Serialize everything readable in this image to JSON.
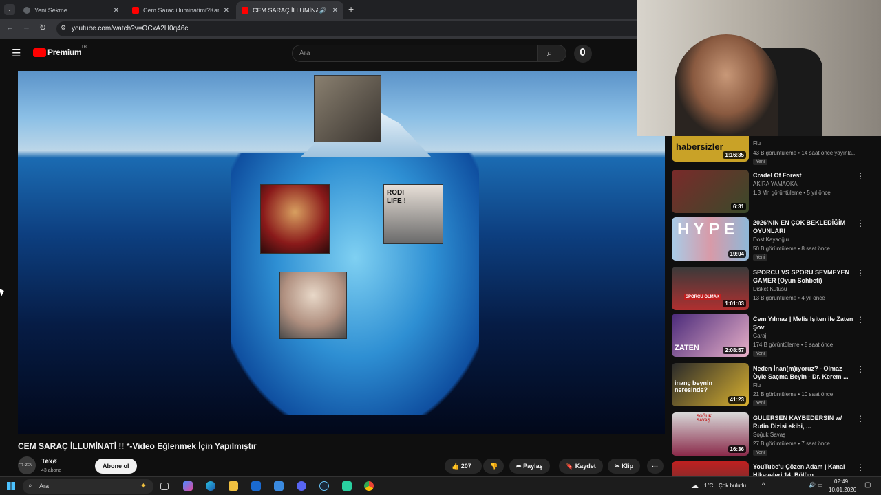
{
  "browser": {
    "tabs": [
      {
        "label": "Yeni Sekme",
        "fav": "#5f6368"
      },
      {
        "label": "Cem Sarac illuminatimi?Kanitla",
        "fav": "#ff0000"
      },
      {
        "label": "CEM SARAÇ İLLUMİNATİ !!",
        "fav": "#ff0000"
      }
    ],
    "url": "youtube.com/watch?v=OCxA2H0q46c"
  },
  "youtube": {
    "logo": "Premium",
    "region": "TR",
    "search_placeholder": "Ara"
  },
  "video": {
    "title": "CEM SARAÇ İLLUMİNATİ !! *-Video Eğlenmek İçin Yapılmıştır",
    "channel": "Texø",
    "channel_avatar_text": "FR⋆ZEN",
    "subscribers": "43 abone",
    "subscribe_label": "Abone ol",
    "likes": "207",
    "share": "Paylaş",
    "save": "Kaydet",
    "clip": "Klip",
    "overlay_text": "RODI LIFE !"
  },
  "recommendations": [
    {
      "title": "",
      "thumb_text": "habersizler",
      "channel": "Flu",
      "meta": "43 B görüntüleme • 14 saat önce yayınla...",
      "duration": "1:16:35",
      "badge": "Yeni",
      "color": "#c9a227"
    },
    {
      "title": "Cradel Of Forest",
      "thumb_text": "",
      "channel": "AKIRA YAMAOKA",
      "meta": "1,3 Mn görüntüleme • 5 yıl önce",
      "duration": "6:31",
      "badge": "",
      "color": "#5a3a2a"
    },
    {
      "title": "2026'NIN EN ÇOK BEKLEDİĞİM OYUNLARI",
      "thumb_text": "HYPE",
      "channel": "Dost Kayaoğlu",
      "meta": "50 B görüntüleme • 8 saat önce",
      "duration": "19:04",
      "badge": "Yeni",
      "color": "#8fb8d8"
    },
    {
      "title": "SPORCU VS SPORU SEVMEYEN GAMER (Oyun Sohbeti)",
      "thumb_text": "SPORCU OLMAK",
      "channel": "Disket Kutusu",
      "meta": "13 B görüntüleme • 4 yıl önce",
      "duration": "1:01:03",
      "badge": "",
      "color": "#b03030"
    },
    {
      "title": "Cem Yılmaz | Melis İşiten ile Zaten Şov",
      "thumb_text": "ZATEN",
      "channel": "Garaj",
      "meta": "174 B görüntüleme • 8 saat önce",
      "duration": "2:08:57",
      "badge": "Yeni",
      "color": "#6a3a9a"
    },
    {
      "title": "Neden İnan(m)ıyoruz? - Olmaz Öyle Saçma Beyin - Dr. Kerem ...",
      "thumb_text": "inanç beynin neresinde?",
      "channel": "Flu",
      "meta": "21 B görüntüleme • 10 saat önce",
      "duration": "41:23",
      "badge": "Yeni",
      "color": "#d8b030"
    },
    {
      "title": "GÜLERSEN KAYBEDERSİN w/ Rutin Dizisi ekibi, ...",
      "thumb_text": "SOĞUK SAVAŞ",
      "channel": "Soğuk Savaş",
      "meta": "27 B görüntüleme • 7 saat önce",
      "duration": "16:36",
      "badge": "Yeni",
      "color": "#8a2a4a"
    },
    {
      "title": "YouTube'u Çözen Adam | Kanal Hikayeleri 14. Bölüm",
      "thumb_text": "",
      "channel": "",
      "meta": "",
      "duration": "",
      "badge": "",
      "color": "#3a3a3a"
    }
  ],
  "taskbar": {
    "search": "Ara",
    "weather": "1°C",
    "weather_desc": "Çok bulutlu",
    "time": "02:49",
    "date": "10.01.2026"
  }
}
